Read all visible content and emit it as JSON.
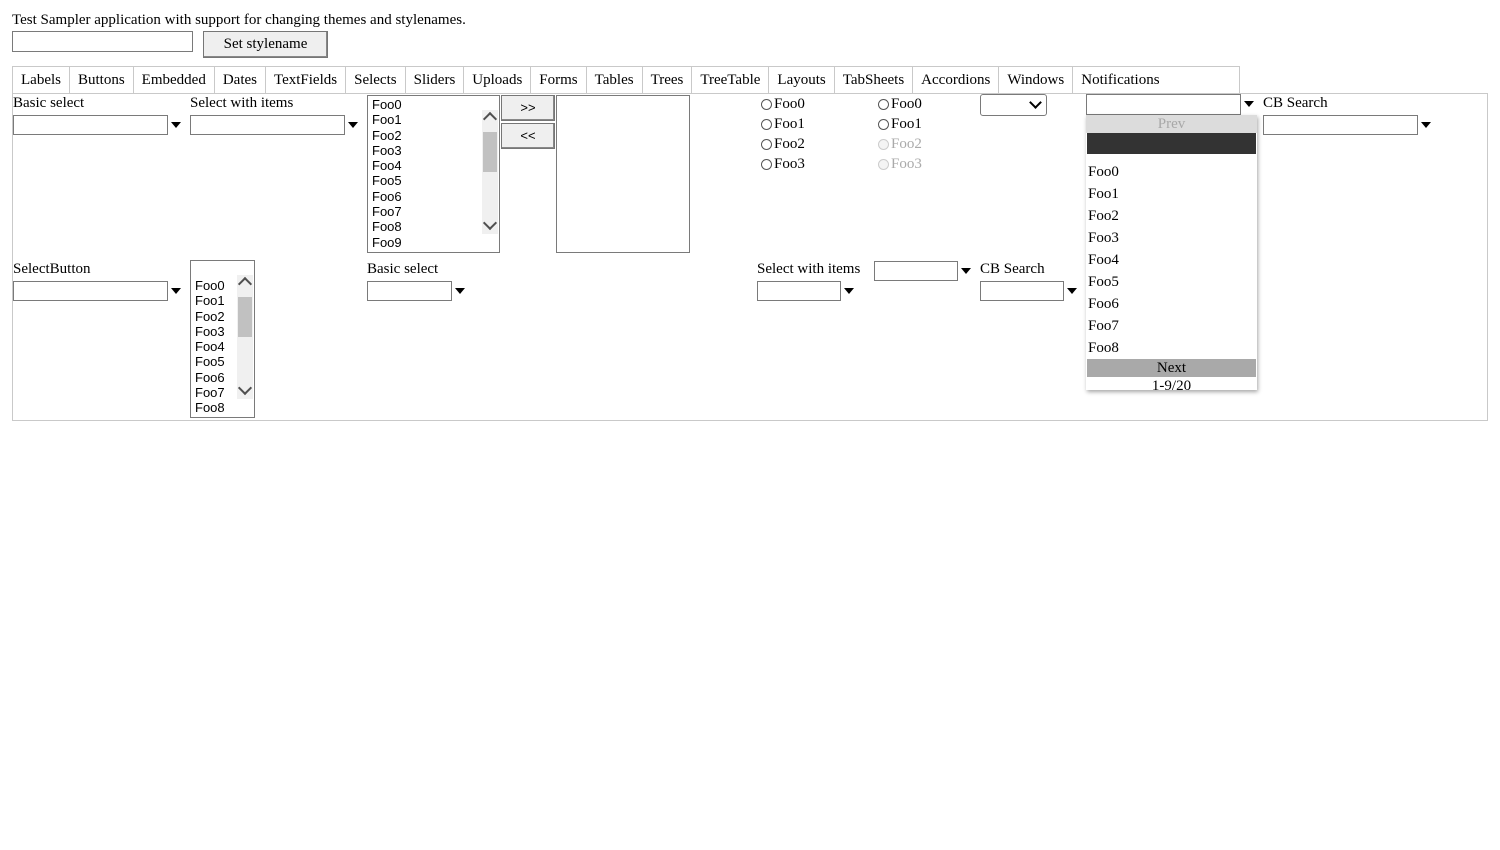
{
  "intro_text": "Test Sampler application with support for changing themes and stylenames.",
  "stylename": {
    "value": "",
    "button_label": "Set stylename"
  },
  "tabs": [
    "Labels",
    "Buttons",
    "Embedded",
    "Dates",
    "TextFields",
    "Selects",
    "Sliders",
    "Uploads",
    "Forms",
    "Tables",
    "Trees",
    "TreeTable",
    "Layouts",
    "TabSheets",
    "Accordions",
    "Windows",
    "Notifications"
  ],
  "selects": {
    "basic_select_label": "Basic select",
    "select_with_items_label": "Select with items",
    "listbox_items": [
      "Foo0",
      "Foo1",
      "Foo2",
      "Foo3",
      "Foo4",
      "Foo5",
      "Foo6",
      "Foo7",
      "Foo8",
      "Foo9"
    ],
    "twincol_add": ">>",
    "twincol_remove": "<<",
    "radio_group_1": [
      "Foo0",
      "Foo1",
      "Foo2",
      "Foo3"
    ],
    "radio_group_2": [
      "Foo0",
      "Foo1",
      "Foo2",
      "Foo3"
    ],
    "cb_search_label": "CB Search",
    "selectbutton_label": "SelectButton",
    "small_listbox_items": [
      "Foo0",
      "Foo1",
      "Foo2",
      "Foo3",
      "Foo4",
      "Foo5",
      "Foo6",
      "Foo7",
      "Foo8"
    ],
    "basic_select_2_label": "Basic select",
    "select_with_items_2_label": "Select with items",
    "cb_search_2_label": "CB Search"
  },
  "popup": {
    "prev_label": "Prev",
    "items": [
      "Foo0",
      "Foo1",
      "Foo2",
      "Foo3",
      "Foo4",
      "Foo5",
      "Foo6",
      "Foo7",
      "Foo8"
    ],
    "next_label": "Next",
    "status": "1-9/20"
  },
  "icons": {
    "dropdown": "caret-down-icon",
    "scroll_up": "chevron-up-icon",
    "scroll_down": "chevron-down-icon"
  }
}
